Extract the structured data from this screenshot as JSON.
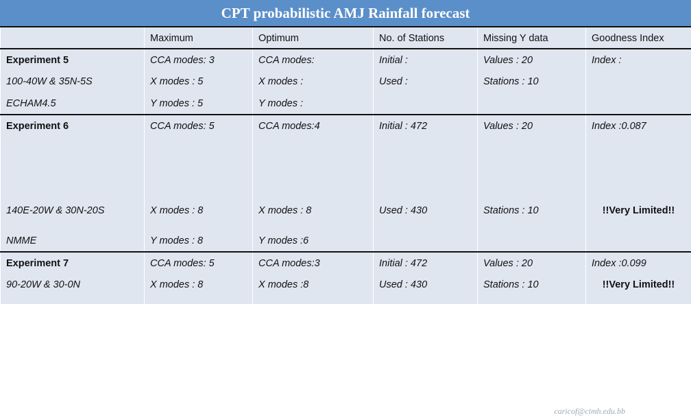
{
  "slide": {
    "title": "CPT probabilistic AMJ Rainfall forecast",
    "credit": "caricof@cimh.edu.bb",
    "accent_color": "#5b8fc9",
    "warn_color": "#d81212",
    "cell_bg": "#dfe6f0",
    "header_bg": "#c9d6e8"
  },
  "table": {
    "columns": [
      {
        "label": ""
      },
      {
        "label": "Maximum"
      },
      {
        "label": "Optimum"
      },
      {
        "label": "No. of Stations"
      },
      {
        "label": "Missing Y data"
      },
      {
        "label": "Goodness Index"
      }
    ],
    "rows": [
      {
        "style": "experiment-heading",
        "cells": [
          "Experiment 5",
          "CCA modes: 3",
          "CCA modes:",
          "Initial :",
          "Values : 20",
          "Index :"
        ]
      },
      {
        "style": "detail",
        "cells": [
          "100-40W & 35N-5S",
          "X modes : 5",
          "X modes :",
          "Used :",
          "Stations : 10",
          ""
        ]
      },
      {
        "style": "detail",
        "cells": [
          "ECHAM4.5",
          "Y modes : 5",
          "Y modes :",
          "",
          "",
          ""
        ]
      },
      {
        "style": "experiment-heading",
        "cells": [
          "Experiment 6",
          "CCA modes: 5",
          "CCA modes:4",
          "Initial : 472",
          "Values : 20",
          "Index :0.087"
        ]
      },
      {
        "style": "detail",
        "cells": [
          "140E-20W & 30N-20S",
          "X modes : 8",
          "X modes : 8",
          "Used : 430",
          "Stations : 10",
          "!!Very Limited!!"
        ]
      },
      {
        "style": "detail",
        "cells": [
          "NMME",
          "Y modes : 8",
          "Y modes :6",
          "",
          "",
          ""
        ]
      },
      {
        "style": "experiment-heading",
        "cells": [
          "Experiment 7",
          "CCA modes: 5",
          "CCA modes:3",
          "Initial : 472",
          "Values : 20",
          "Index :0.099"
        ]
      },
      {
        "style": "detail",
        "cells": [
          "90-20W & 30-0N",
          "X modes : 8",
          "X modes :8",
          "Used : 430",
          "Stations : 10",
          "!!Very Limited!!"
        ]
      }
    ]
  }
}
